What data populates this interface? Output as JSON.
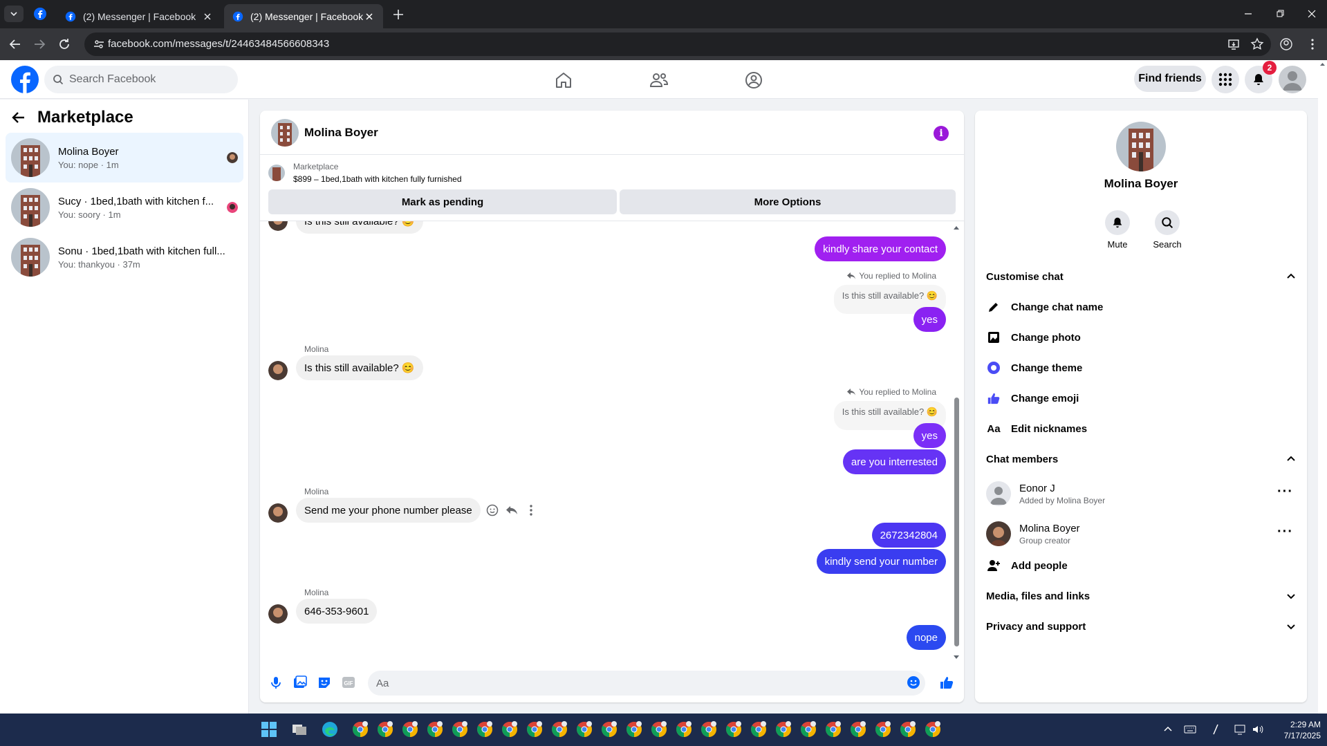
{
  "browser": {
    "tabs": [
      {
        "title": "(2) Messenger | Facebook",
        "active": false
      },
      {
        "title": "(2) Messenger | Facebook",
        "active": true
      }
    ],
    "url": "facebook.com/messages/t/24463484566608343"
  },
  "fb": {
    "search_placeholder": "Search Facebook",
    "find_friends": "Find friends",
    "notification_count": "2"
  },
  "sidebar": {
    "title": "Marketplace",
    "conversations": [
      {
        "name": "Molina Boyer",
        "subtitle": "You: nope · 1m",
        "selected": true
      },
      {
        "name": "Sucy · 1bed,1bath with kitchen f...",
        "subtitle": "You: soory · 1m",
        "selected": false
      },
      {
        "name": "Sonu · 1bed,1bath with kitchen full...",
        "subtitle": "You: thankyou · 37m",
        "selected": false
      }
    ]
  },
  "chat": {
    "name": "Molina Boyer",
    "info_label": "i",
    "listing_label": "Marketplace",
    "listing_desc": "$899 – 1bed,1bath with kitchen fully furnished",
    "mark_pending": "Mark as pending",
    "more_options": "More Options",
    "composer_placeholder": "Aa",
    "messages": {
      "top_partial": "Is this still available? 😊",
      "m1": "kindly share your contact",
      "reply_note_1": "You replied to Molina",
      "quote_1": "Is this still available? 😊",
      "m2": "yes",
      "sender_1": "Molina",
      "in_1": "Is this still available? 😊",
      "reply_note_2": "You replied to Molina",
      "quote_2": "Is this still available? 😊",
      "m3": "yes",
      "m4": "are you interrested",
      "sender_2": "Molina",
      "in_2": "Send me your phone number please",
      "m5": "2672342804",
      "m6": "kindly send your  number",
      "sender_3": "Molina",
      "in_3": "646-353-9601",
      "m7": "nope"
    }
  },
  "details": {
    "name": "Molina Boyer",
    "mute": "Mute",
    "search": "Search",
    "customise_chat": "Customise chat",
    "change_chat_name": "Change chat name",
    "change_photo": "Change photo",
    "change_theme": "Change theme",
    "change_emoji": "Change emoji",
    "edit_nicknames": "Edit nicknames",
    "nick_icon": "Aa",
    "chat_members": "Chat members",
    "members": [
      {
        "name": "Eonor J",
        "sub": "Added by Molina Boyer"
      },
      {
        "name": "Molina Boyer",
        "sub": "Group creator"
      }
    ],
    "add_people": "Add people",
    "media": "Media, files and links",
    "privacy": "Privacy and support"
  },
  "taskbar": {
    "time": "2:29 AM",
    "date": "7/17/2025"
  },
  "colors": {
    "fb_blue": "#0866ff",
    "msg_purple": "#a020f0",
    "msg_violet": "#7b2ff7",
    "msg_blue": "#3a3df0"
  }
}
